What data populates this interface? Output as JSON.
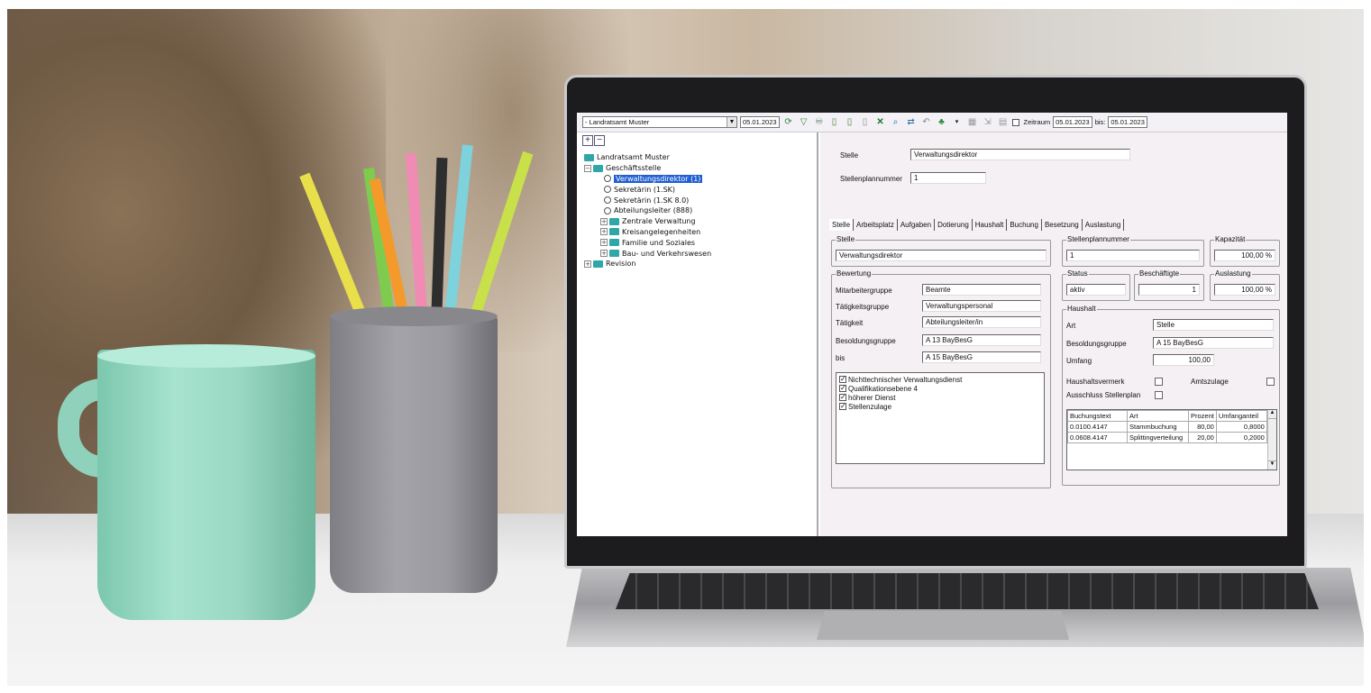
{
  "toolbar": {
    "org_select": "- Landratsamt Muster",
    "date_from": "05.01.2023",
    "zeitraum_label": "Zeitraum",
    "zeitraum_date": "05.01.2023",
    "bis_label": "bis:",
    "bis_date": "05.01.2023"
  },
  "tree": {
    "expand_label": "+",
    "collapse_label": "−",
    "root": "Landratsamt Muster",
    "group1": "Geschäftsstelle",
    "item_selected": "Verwaltungsdirektor (1)",
    "item2": "Sekretärin (1.SK)",
    "item3": "Sekretärin (1.SK 8.0)",
    "item4": "Abteilungsleiter (888)",
    "group2": "Zentrale Verwaltung",
    "group3": "Kreisangelegenheiten",
    "group4": "Familie und Soziales",
    "group5": "Bau- und Verkehrswesen",
    "group6": "Revision"
  },
  "header": {
    "stelle_label": "Stelle",
    "stelle_value": "Verwaltungsdirektor",
    "stellenplannummer_label": "Stellenplannummer",
    "stellenplannummer_value": "1"
  },
  "tabs": [
    "Stelle",
    "Arbeitsplatz",
    "Aufgaben",
    "Dotierung",
    "Haushalt",
    "Buchung",
    "Besetzung",
    "Auslastung"
  ],
  "stelle_group": {
    "title": "Stelle",
    "value": "Verwaltungsdirektor"
  },
  "stellenplannummer_group": {
    "title": "Stellenplannummer",
    "value": "1"
  },
  "kapazitaet_group": {
    "title": "Kapazität",
    "value": "100,00 %"
  },
  "bewertung": {
    "title": "Bewertung",
    "mitarbeitergruppe_label": "Mitarbeitergruppe",
    "mitarbeitergruppe_value": "Beamte",
    "taetigkeitsgruppe_label": "Tätigkeitsgruppe",
    "taetigkeitsgruppe_value": "Verwaltungspersonal",
    "taetigkeit_label": "Tätigkeit",
    "taetigkeit_value": "Abteilungsleiter/in",
    "besoldungsgruppe_label": "Besoldungsgruppe",
    "besoldungsgruppe_value": "A 13 BayBesG",
    "bis_label": "bis",
    "bis_value": "A 15 BayBesG",
    "checks": [
      "Nichttechnischer Verwaltungsdienst",
      "Qualifikationsebene 4",
      "höherer Dienst",
      "Stellenzulage"
    ]
  },
  "status_group": {
    "title": "Status",
    "value": "aktiv"
  },
  "beschaeftigte_group": {
    "title": "Beschäftigte",
    "value": "1"
  },
  "auslastung_group": {
    "title": "Auslastung",
    "value": "100,00 %"
  },
  "haushalt": {
    "title": "Haushalt",
    "art_label": "Art",
    "art_value": "Stelle",
    "besoldungsgruppe_label": "Besoldungsgruppe",
    "besoldungsgruppe_value": "A 15 BayBesG",
    "umfang_label": "Umfang",
    "umfang_value": "100,00",
    "haushaltsvermerk_label": "Haushaltsvermerk",
    "amtszulage_label": "Amtszulage",
    "ausschluss_label": "Ausschluss Stellenplan",
    "table_headers": [
      "Buchungstext",
      "Art",
      "Prozent",
      "Umfanganteil"
    ],
    "table_rows": [
      [
        "0.0100.4147",
        "Stammbuchung",
        "80,00",
        "0,8000"
      ],
      [
        "0.0608.4147",
        "Splittingverteilung",
        "20,00",
        "0,2000"
      ]
    ]
  }
}
